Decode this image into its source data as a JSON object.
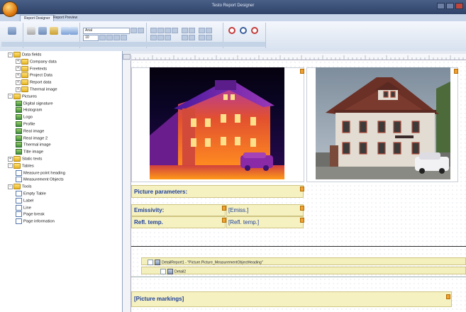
{
  "window": {
    "title": "Testo Report Designer"
  },
  "tabs": [
    {
      "label": "Report Designer",
      "active": true
    },
    {
      "label": "Report Preview",
      "active": false
    }
  ],
  "ribbon": {
    "font_value": "Arial",
    "size_value": "10",
    "icons": [
      "new-icon",
      "open-icon",
      "save-icon",
      "cut-icon",
      "copy-icon",
      "paste-icon",
      "undo-icon",
      "redo-icon",
      "bold-icon",
      "italic-icon",
      "underline-icon",
      "zoom-out-icon",
      "zoom-icon",
      "zoom-in-icon"
    ]
  },
  "tree": [
    {
      "label": "Data fields",
      "level": 0,
      "kind": "folder",
      "expander": "−"
    },
    {
      "label": "Company data",
      "level": 1,
      "kind": "folder",
      "expander": "+"
    },
    {
      "label": "Freetexts",
      "level": 1,
      "kind": "folder",
      "expander": "+"
    },
    {
      "label": "Project Data",
      "level": 1,
      "kind": "folder",
      "expander": "+"
    },
    {
      "label": "Report data",
      "level": 1,
      "kind": "folder",
      "expander": "+"
    },
    {
      "label": "Thermal image",
      "level": 1,
      "kind": "folder",
      "expander": "+"
    },
    {
      "label": "Pictures",
      "level": 0,
      "kind": "folder",
      "expander": "−"
    },
    {
      "label": "Digital signature",
      "level": 1,
      "kind": "picture",
      "expander": ""
    },
    {
      "label": "Histogram",
      "level": 1,
      "kind": "picture",
      "expander": ""
    },
    {
      "label": "Logo",
      "level": 1,
      "kind": "picture",
      "expander": ""
    },
    {
      "label": "Profile",
      "level": 1,
      "kind": "picture",
      "expander": ""
    },
    {
      "label": "Real image",
      "level": 1,
      "kind": "picture",
      "expander": ""
    },
    {
      "label": "Real image 2",
      "level": 1,
      "kind": "picture",
      "expander": ""
    },
    {
      "label": "Thermal image",
      "level": 1,
      "kind": "picture",
      "expander": ""
    },
    {
      "label": "Title image",
      "level": 1,
      "kind": "picture",
      "expander": ""
    },
    {
      "label": "Static texts",
      "level": 0,
      "kind": "folder",
      "expander": "+"
    },
    {
      "label": "Tables",
      "level": 0,
      "kind": "folder",
      "expander": "−"
    },
    {
      "label": "Measure point heading",
      "level": 1,
      "kind": "table",
      "expander": ""
    },
    {
      "label": "Measurement Objects",
      "level": 1,
      "kind": "table",
      "expander": ""
    },
    {
      "label": "Tools",
      "level": 0,
      "kind": "folder",
      "expander": "−"
    },
    {
      "label": "Empty Table",
      "level": 1,
      "kind": "table",
      "expander": ""
    },
    {
      "label": "Label",
      "level": 1,
      "kind": "table",
      "expander": ""
    },
    {
      "label": "Line",
      "level": 1,
      "kind": "table",
      "expander": ""
    },
    {
      "label": "Page break",
      "level": 1,
      "kind": "table",
      "expander": ""
    },
    {
      "label": "Page information",
      "level": 1,
      "kind": "table",
      "expander": ""
    }
  ],
  "report": {
    "picture_parameters": "Picture parameters:",
    "emissivity_label": "Emissivity:",
    "emissivity_value": "[Emiss.]",
    "refl_label": "Refl. temp.",
    "refl_value": "[Refl. temp.]",
    "detail_report": "DetailReport1 - \"Picture.Picture_MeasurementObjectHeading\"",
    "detail2": "Detail2",
    "picture_markings": "[Picture markings]"
  },
  "colors": {
    "band_fill": "#f5f1c0",
    "band_text": "#1e3f9e",
    "anchor": "#f0a030"
  }
}
